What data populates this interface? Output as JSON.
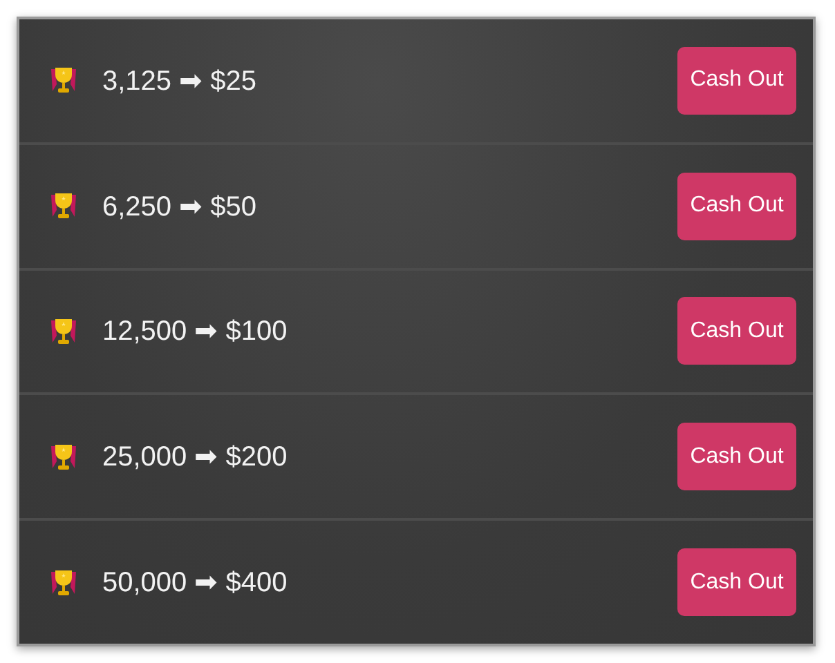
{
  "offers": [
    {
      "exchange": "3,125 ➡ $25",
      "button": "Cash Out"
    },
    {
      "exchange": "6,250 ➡ $50",
      "button": "Cash Out"
    },
    {
      "exchange": "12,500 ➡ $100",
      "button": "Cash Out"
    },
    {
      "exchange": "25,000 ➡ $200",
      "button": "Cash Out"
    },
    {
      "exchange": "50,000 ➡ $400",
      "button": "Cash Out"
    }
  ]
}
